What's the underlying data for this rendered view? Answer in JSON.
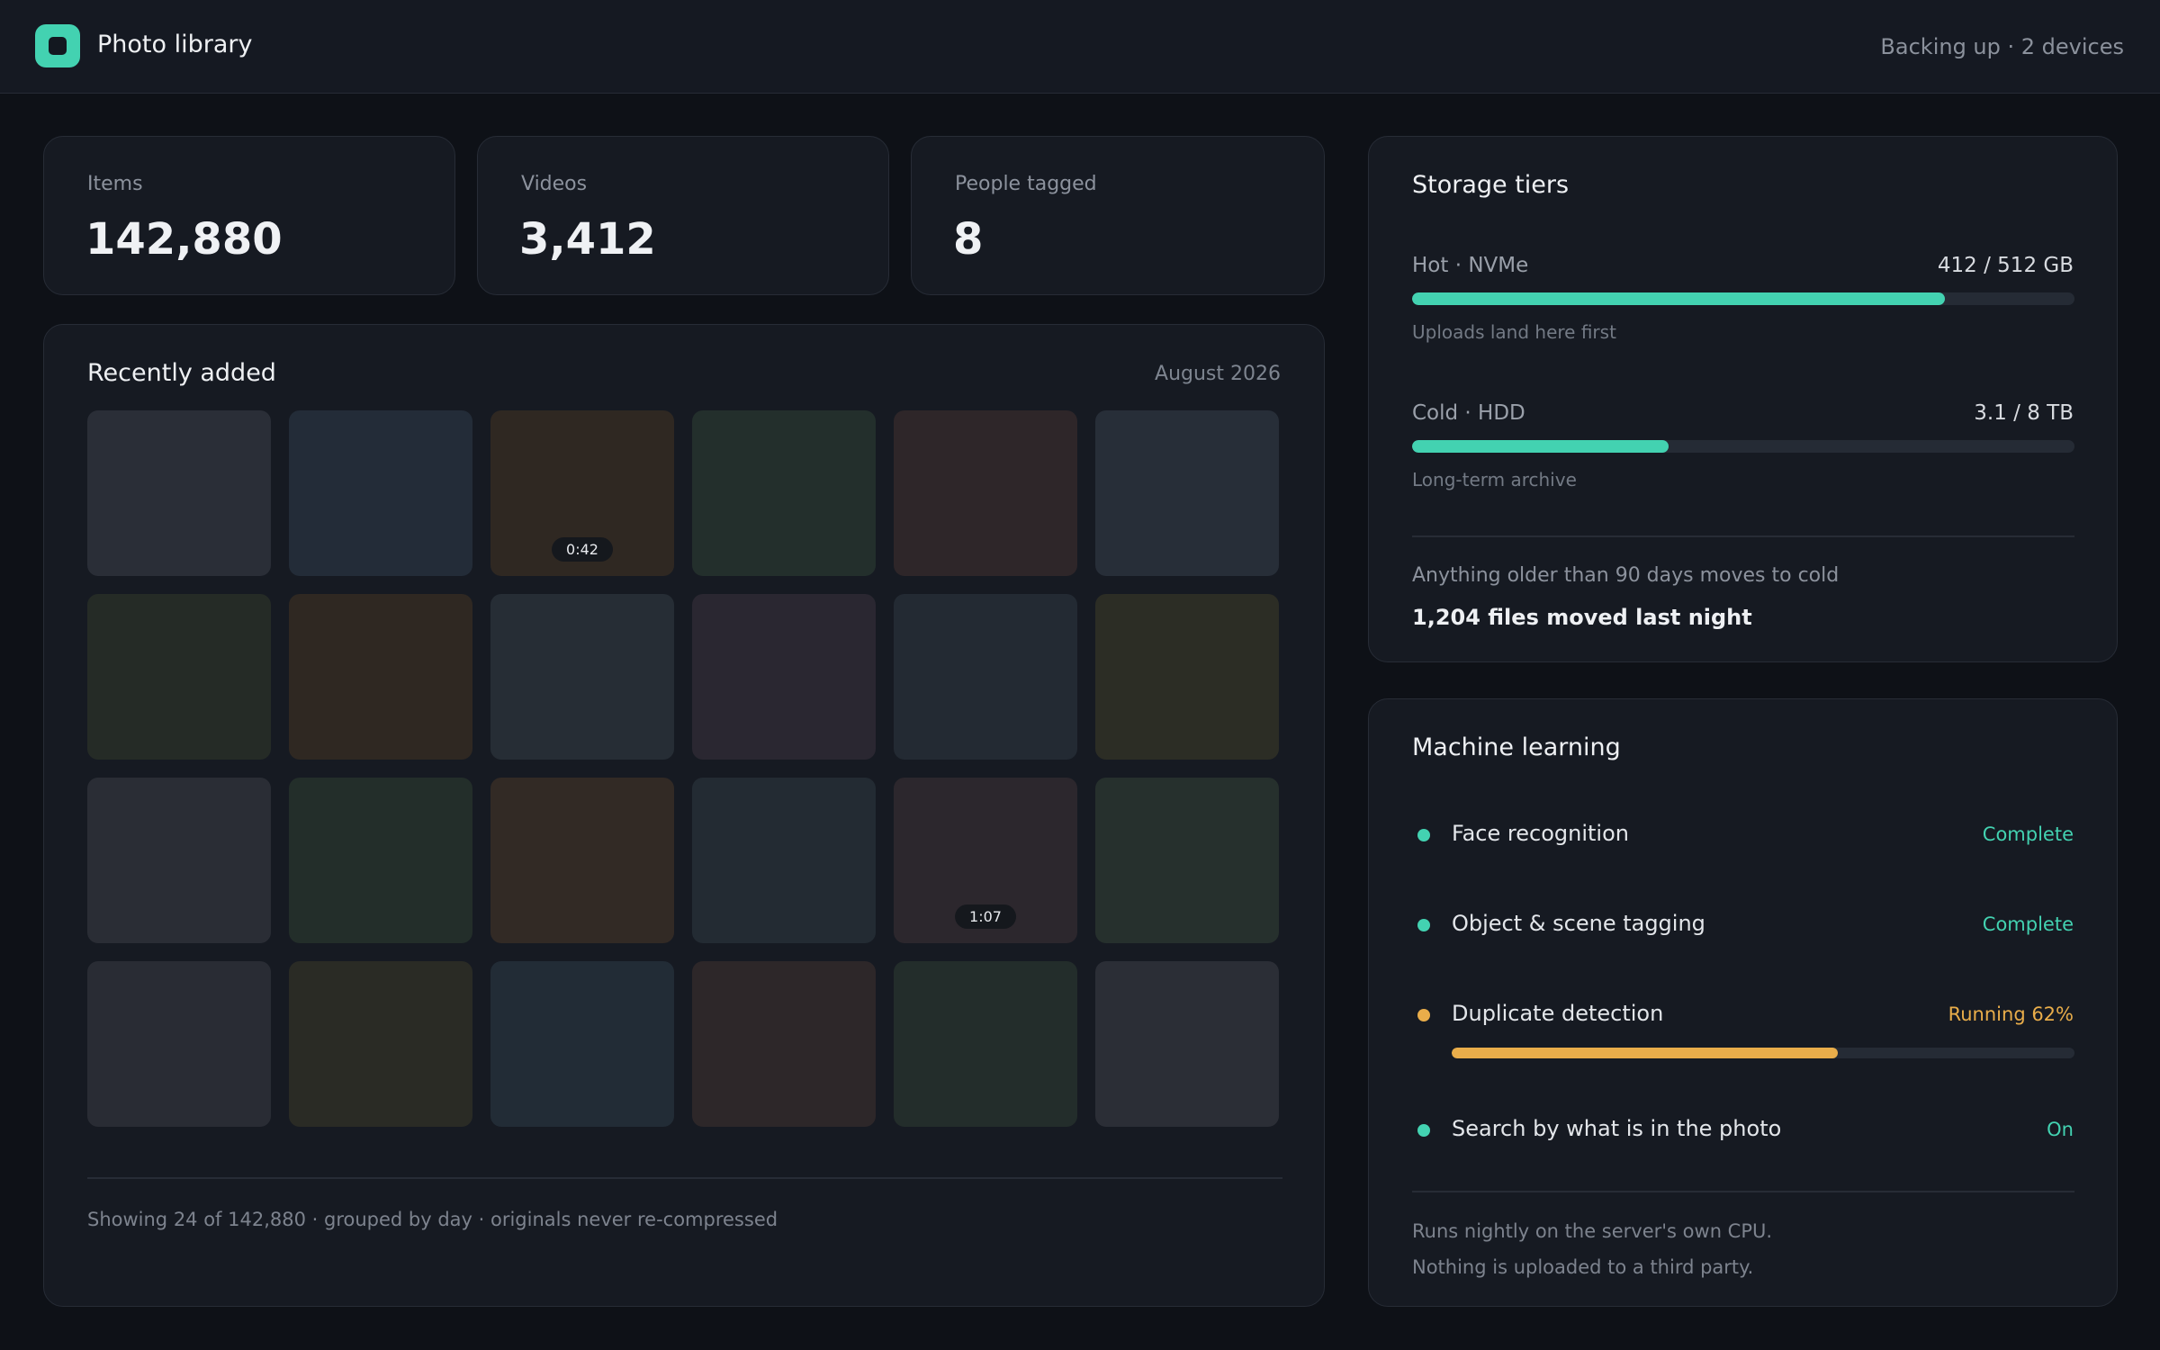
{
  "app": {
    "title": "Photo library",
    "status": "Backing up · 2 devices",
    "logo_icon": "app-logo-icon",
    "accent": "#43d2b1"
  },
  "stats": [
    {
      "label": "Items",
      "value": "142,880"
    },
    {
      "label": "Videos",
      "value": "3,412"
    },
    {
      "label": "People tagged",
      "value": "8"
    }
  ],
  "recent": {
    "title": "Recently added",
    "period": "August 2026",
    "footer": "Showing 24 of 142,880 · grouped by day · originals never re-compressed",
    "tiles": [
      {
        "color": "#2a2e37"
      },
      {
        "color": "#232c38"
      },
      {
        "color": "#2f2822",
        "duration": "0:42"
      },
      {
        "color": "#232f2c"
      },
      {
        "color": "#2e2629"
      },
      {
        "color": "#272e38"
      },
      {
        "color": "#252b26"
      },
      {
        "color": "#2f2822"
      },
      {
        "color": "#262d35"
      },
      {
        "color": "#2a2731"
      },
      {
        "color": "#232a33"
      },
      {
        "color": "#2c2d25"
      },
      {
        "color": "#2a2d35"
      },
      {
        "color": "#232e2a"
      },
      {
        "color": "#322a25"
      },
      {
        "color": "#232b33"
      },
      {
        "color": "#2c272d",
        "duration": "1:07"
      },
      {
        "color": "#26302d"
      },
      {
        "color": "#292c34"
      },
      {
        "color": "#2a2b25"
      },
      {
        "color": "#222c36"
      },
      {
        "color": "#2d2729"
      },
      {
        "color": "#232d2b"
      },
      {
        "color": "#2b2e36"
      }
    ]
  },
  "storage": {
    "title": "Storage tiers",
    "tiers": [
      {
        "name": "Hot · NVMe",
        "amount": "412 / 512 GB",
        "used_fraction": 0.804,
        "description": "Uploads land here first",
        "color": "#43d2b1"
      },
      {
        "name": "Cold · HDD",
        "amount": "3.1 / 8 TB",
        "used_fraction": 0.3875,
        "description": "Long-term archive",
        "color": "#43d2b1"
      }
    ],
    "policy": "Anything older than 90 days moves to cold",
    "moved": "1,204 files moved last night"
  },
  "ml": {
    "title": "Machine learning",
    "tasks": [
      {
        "label": "Face recognition",
        "status": "Complete",
        "color": "#43d2b1"
      },
      {
        "label": "Object & scene tagging",
        "status": "Complete",
        "color": "#43d2b1"
      },
      {
        "label": "Duplicate detection",
        "status": "Running 62%",
        "progress": 0.62,
        "color": "#e9ad4a"
      },
      {
        "label": "Search by what is in the photo",
        "status": "On",
        "color": "#43d2b1"
      }
    ],
    "notes": [
      "Runs nightly on the server's own CPU.",
      "Nothing is uploaded to a third party."
    ]
  }
}
